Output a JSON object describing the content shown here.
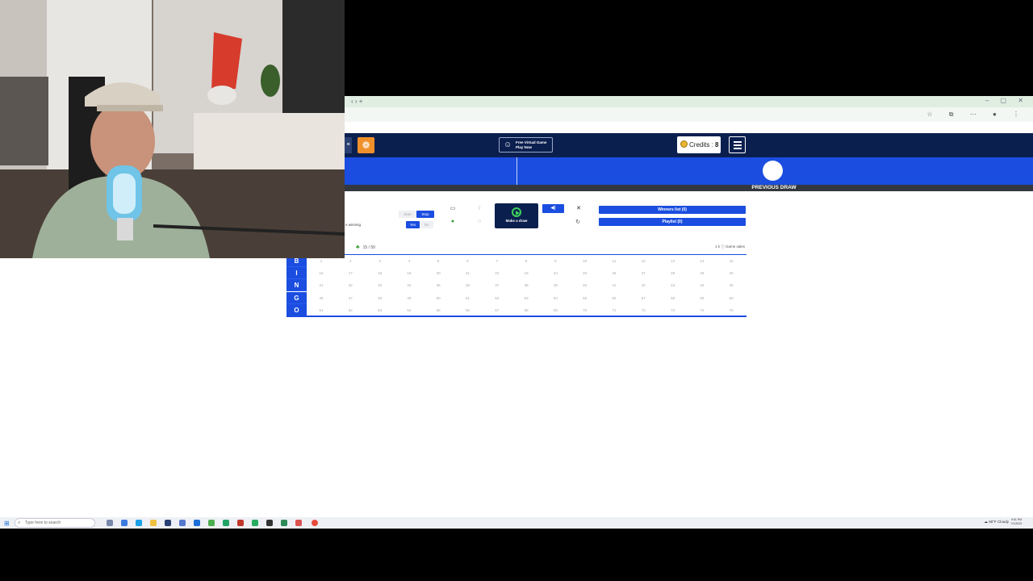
{
  "browser": {
    "nav_glyphs": "‹ › +",
    "window_controls": "– ▢ ✕",
    "toolbar_glyphs": "☆ ⧉ ⋯ ● ⋮"
  },
  "nav": {
    "edge_glyph": "≡",
    "logo_glyph": "❁",
    "free_game_line1": "Free Virtual Game",
    "free_game_line2": "Play Now",
    "credits_label": "Credits : ",
    "credits_value": "8"
  },
  "draw": {
    "previous_label": "PREVIOUS DRAW"
  },
  "controls": {
    "auto_winning_label": "e winning",
    "toggle1": {
      "left": "Start",
      "right": "Stop"
    },
    "toggle2": {
      "left": "Yes",
      "right": "No"
    },
    "make_draw_label": "Make a draw",
    "winners_label": "Winners list (0)",
    "playlist_label": "Playlist (0)"
  },
  "board": {
    "count_label": "15 / 50",
    "right_count": "1 k",
    "right_label": "Game sales",
    "rows": [
      {
        "letter": "B",
        "numbers": [
          "1",
          "2",
          "3",
          "4",
          "5",
          "6",
          "7",
          "8",
          "9",
          "10",
          "11",
          "12",
          "13",
          "14",
          "15"
        ]
      },
      {
        "letter": "I",
        "numbers": [
          "16",
          "17",
          "18",
          "19",
          "20",
          "21",
          "22",
          "23",
          "24",
          "25",
          "26",
          "27",
          "28",
          "29",
          "30"
        ]
      },
      {
        "letter": "N",
        "numbers": [
          "31",
          "32",
          "33",
          "34",
          "35",
          "36",
          "37",
          "38",
          "39",
          "40",
          "41",
          "42",
          "43",
          "44",
          "45"
        ]
      },
      {
        "letter": "G",
        "numbers": [
          "46",
          "47",
          "48",
          "49",
          "50",
          "51",
          "52",
          "53",
          "54",
          "55",
          "56",
          "57",
          "58",
          "59",
          "60"
        ]
      },
      {
        "letter": "O",
        "numbers": [
          "61",
          "62",
          "63",
          "64",
          "65",
          "66",
          "67",
          "68",
          "69",
          "70",
          "71",
          "72",
          "73",
          "74",
          "75"
        ]
      }
    ]
  },
  "taskbar": {
    "search_placeholder": "Type here to search",
    "weather": "58°F  Cloudy",
    "time": "9:51 PM",
    "date": "7/1/2023"
  },
  "colors": {
    "nav_dark": "#0b1f4f",
    "primary_blue": "#1a4de0",
    "accent_orange": "#f0902a",
    "play_green": "#3ed15a"
  }
}
